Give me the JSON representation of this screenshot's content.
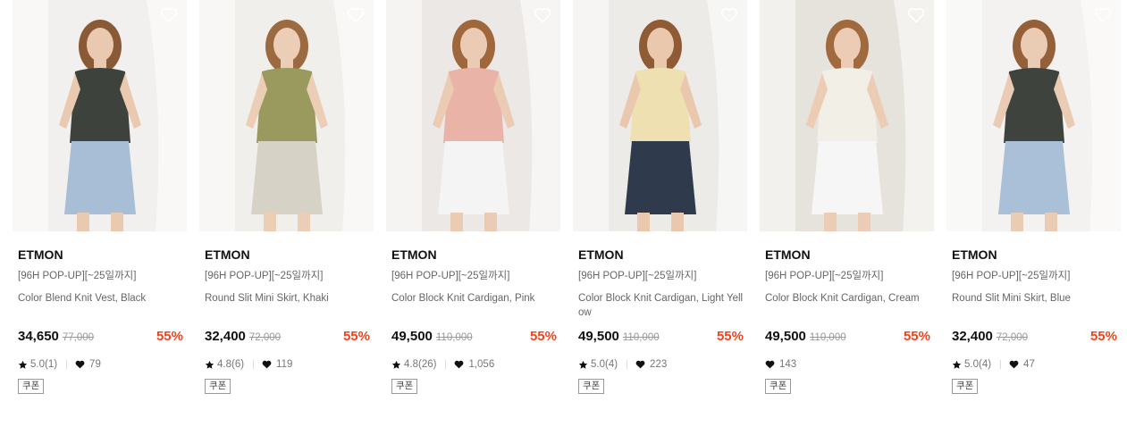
{
  "products": [
    {
      "brand": "ETMON",
      "promo": "[96H POP-UP][~25일까지]",
      "name": "Color Blend Knit Vest, Black",
      "price": "34,650",
      "original_price": "77,000",
      "discount": "55%",
      "rating": "5.0(1)",
      "likes": "79",
      "badge": "쿠폰",
      "colors": {
        "bg": "#f2f0ee",
        "top": "#3d423c",
        "bottom": "#a8bdd6",
        "skin": "#e9c9b0",
        "hair": "#8a5a36"
      }
    },
    {
      "brand": "ETMON",
      "promo": "[96H POP-UP][~25일까지]",
      "name": "Round Slit Mini Skirt, Khaki",
      "price": "32,400",
      "original_price": "72,000",
      "discount": "55%",
      "rating": "4.8(6)",
      "likes": "119",
      "badge": "쿠폰",
      "colors": {
        "bg": "#f1efec",
        "top": "#9a9a5e",
        "bottom": "#d7d2c6",
        "skin": "#ecceb6",
        "hair": "#9c6a40"
      }
    },
    {
      "brand": "ETMON",
      "promo": "[96H POP-UP][~25일까지]",
      "name": "Color Block Knit Cardigan, Pink",
      "price": "49,500",
      "original_price": "110,000",
      "discount": "55%",
      "rating": "4.8(26)",
      "likes": "1,056",
      "badge": "쿠폰",
      "colors": {
        "bg": "#ebe8e6",
        "top": "#eab3a8",
        "bottom": "#f4f4f4",
        "skin": "#ebcbb4",
        "hair": "#a0673d"
      }
    },
    {
      "brand": "ETMON",
      "promo": "[96H POP-UP][~25일까지]",
      "name": "Color Block Knit Cardigan, Light Yellow",
      "price": "49,500",
      "original_price": "110,000",
      "discount": "55%",
      "rating": "5.0(4)",
      "likes": "223",
      "badge": "쿠폰",
      "colors": {
        "bg": "#ecebe8",
        "top": "#eee0b0",
        "bottom": "#2f3b4d",
        "skin": "#e9c8ae",
        "hair": "#8f5b35"
      }
    },
    {
      "brand": "ETMON",
      "promo": "[96H POP-UP][~25일까지]",
      "name": "Color Block Knit Cardigan, Cream",
      "price": "49,500",
      "original_price": "110,000",
      "discount": "55%",
      "rating": "",
      "likes": "143",
      "badge": "쿠폰",
      "colors": {
        "bg": "#e6e2dc",
        "top": "#f2efe6",
        "bottom": "#f6f6f6",
        "skin": "#ecccb5",
        "hair": "#a06a3e"
      }
    },
    {
      "brand": "ETMON",
      "promo": "[96H POP-UP][~25일까지]",
      "name": "Round Slit Mini Skirt, Blue",
      "price": "32,400",
      "original_price": "72,000",
      "discount": "55%",
      "rating": "5.0(4)",
      "likes": "47",
      "badge": "쿠폰",
      "colors": {
        "bg": "#f3f2f0",
        "top": "#3e433e",
        "bottom": "#a9c0d8",
        "skin": "#eacbb3",
        "hair": "#94603a"
      }
    }
  ],
  "icons": {
    "wishlist": "heart-outline-icon",
    "rating": "star-icon",
    "likes": "heart-icon"
  },
  "accent": {
    "discount": "#f0441e"
  }
}
